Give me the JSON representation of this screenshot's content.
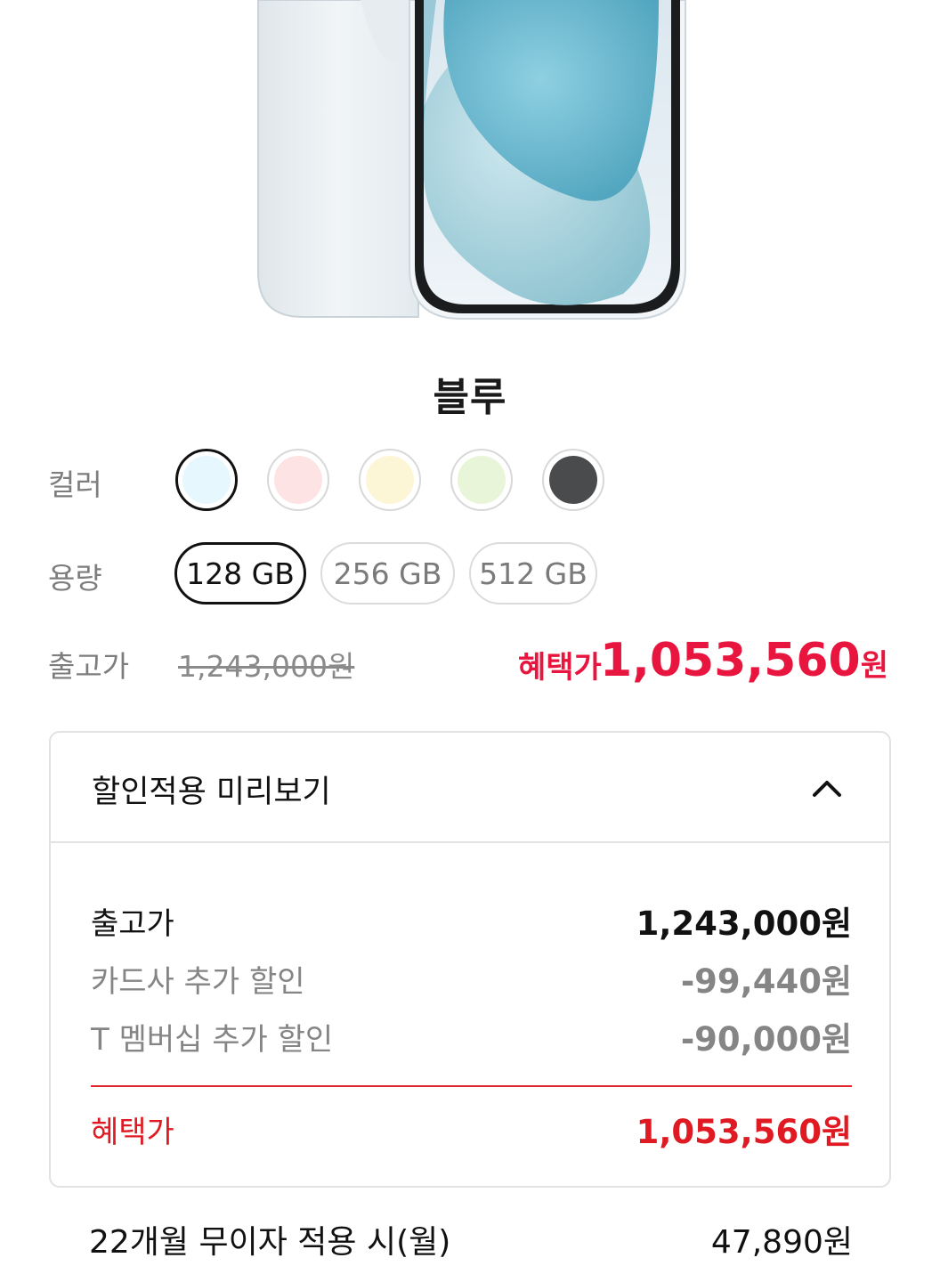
{
  "product": {
    "color_name": "블루"
  },
  "options": {
    "color_label": "컬러",
    "colors": [
      {
        "name": "blue",
        "hex": "#e6f7fd",
        "selected": true
      },
      {
        "name": "pink",
        "hex": "#fde3e3",
        "selected": false
      },
      {
        "name": "yellow",
        "hex": "#fdf6d6",
        "selected": false
      },
      {
        "name": "green",
        "hex": "#e8f5d8",
        "selected": false
      },
      {
        "name": "black",
        "hex": "#4a4b4d",
        "selected": false
      }
    ],
    "capacity_label": "용량",
    "capacities": [
      "128 GB",
      "256 GB",
      "512 GB"
    ],
    "capacity_selected": "128 GB"
  },
  "pricing": {
    "release_label": "출고가",
    "release_price": "1,243,000원",
    "benefit_label": "혜택가",
    "benefit_price": "1,053,560",
    "currency": "원",
    "accent_color": "#e8153e"
  },
  "discount_preview": {
    "title": "할인적용 미리보기",
    "expanded": true,
    "rows": [
      {
        "label": "출고가",
        "value": "1,243,000원"
      },
      {
        "label": "카드사 추가 할인",
        "value": "-99,440원"
      },
      {
        "label": "T 멤버십 추가 할인",
        "value": "-90,000원"
      }
    ],
    "total_label": "혜택가",
    "total_value": "1,053,560원"
  },
  "installment": {
    "label": "22개월 무이자 적용 시(월)",
    "value": "47,890원"
  }
}
